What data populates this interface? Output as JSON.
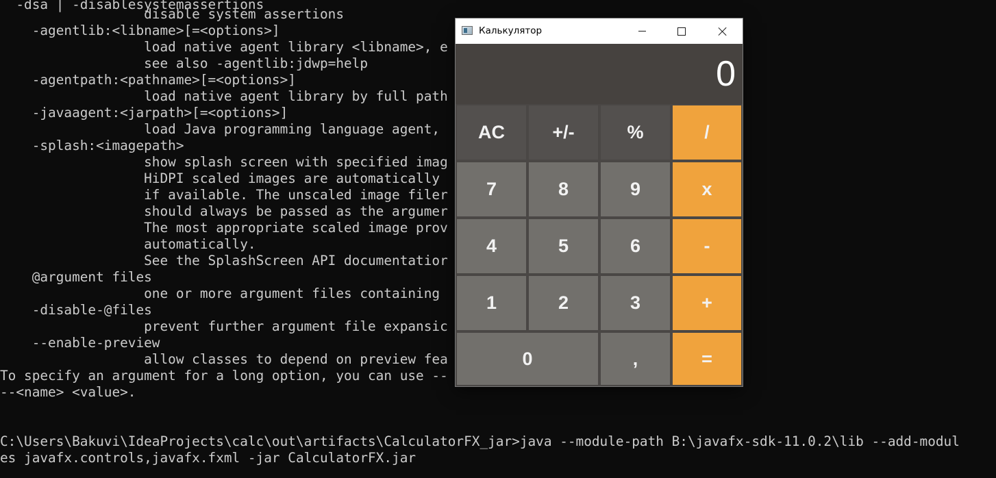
{
  "terminal": {
    "lines": [
      "  -dsa | -disablesystemassertions",
      "                  disable system assertions",
      "    -agentlib:<libname>[=<options>]",
      "                  load native agent library <libname>, e",
      "                  see also -agentlib:jdwp=help",
      "    -agentpath:<pathname>[=<options>]",
      "                  load native agent library by full path",
      "    -javaagent:<jarpath>[=<options>]",
      "                  load Java programming language agent,",
      "    -splash:<imagepath>",
      "                  show splash screen with specified imag",
      "                  HiDPI scaled images are automatically",
      "                  if available. The unscaled image filer",
      "                  should always be passed as the argumer",
      "                  The most appropriate scaled image prov",
      "                  automatically.",
      "                  See the SplashScreen API documentatior",
      "    @argument files",
      "                  one or more argument files containing",
      "    -disable-@files",
      "                  prevent further argument file expansic",
      "    --enable-preview",
      "                  allow classes to depend on preview fea",
      "To specify an argument for a long option, you can use --",
      "--<name> <value>.",
      "",
      "",
      "C:\\Users\\Bakuvi\\IdeaProjects\\calc\\out\\artifacts\\CalculatorFX_jar>java --module-path B:\\javafx-sdk-11.0.2\\lib --add-modul",
      "es javafx.controls,javafx.fxml -jar CalculatorFX.jar"
    ]
  },
  "calculator": {
    "window_title": "Калькулятор",
    "display_value": "0",
    "icons": {
      "app": "calculator-app-icon",
      "minimize": "minimize-icon",
      "maximize": "maximize-icon",
      "close": "close-icon"
    },
    "keys": {
      "ac": "AC",
      "sign": "+/-",
      "percent": "%",
      "divide": "/",
      "seven": "7",
      "eight": "8",
      "nine": "9",
      "multiply": "x",
      "four": "4",
      "five": "5",
      "six": "6",
      "minus": "-",
      "one": "1",
      "two": "2",
      "three": "3",
      "plus": "+",
      "zero": "0",
      "comma": ",",
      "equals": "="
    },
    "colors": {
      "display_bg": "#46423f",
      "function_key": "#53504e",
      "number_key": "#72706c",
      "operator_key": "#f0a33d"
    }
  }
}
